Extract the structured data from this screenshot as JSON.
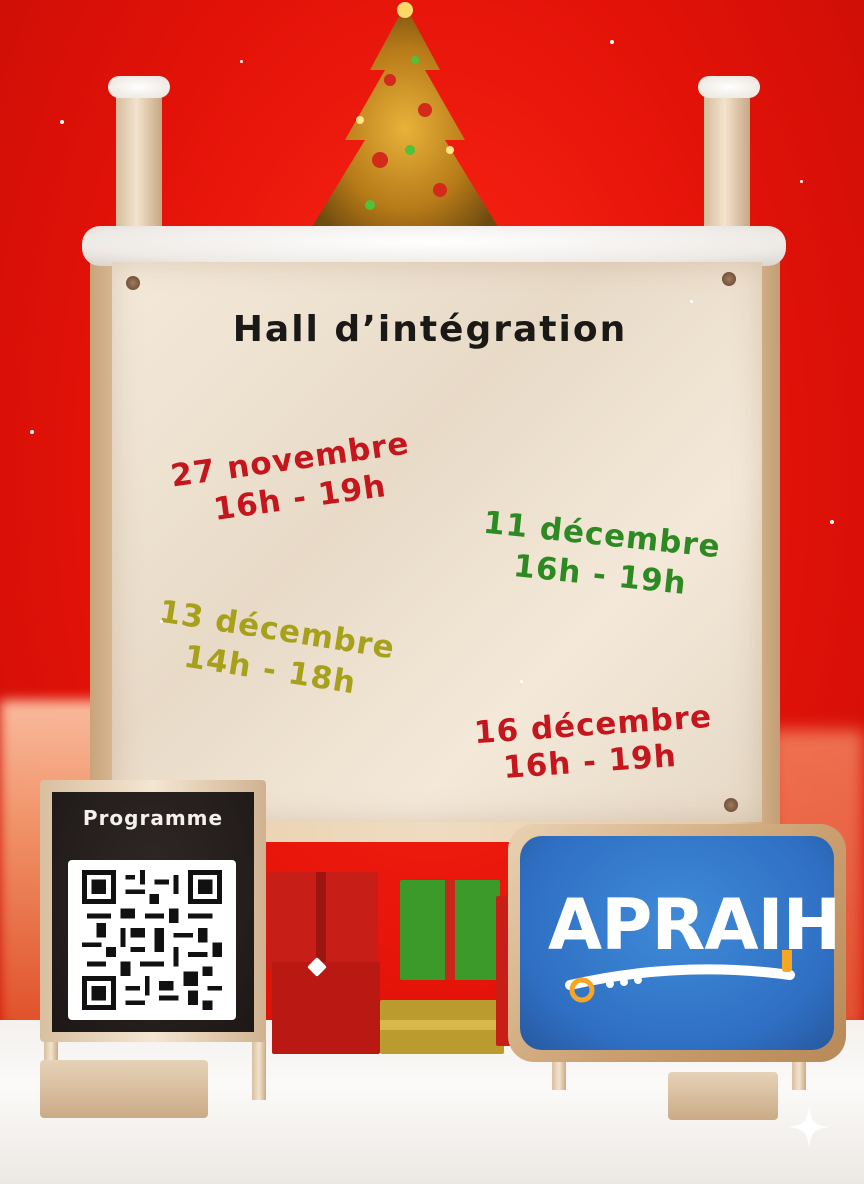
{
  "title": "Hall d’intégration",
  "dates": [
    {
      "date": "27 novembre",
      "hours": "16h - 19h",
      "color": "#c4161c"
    },
    {
      "date": "11 décembre",
      "hours": "16h - 19h",
      "color": "#2d8a22"
    },
    {
      "date": "13 décembre",
      "hours": "14h - 18h",
      "color": "#a7a01a"
    },
    {
      "date": "16 décembre",
      "hours": "16h - 19h",
      "color": "#c4161c"
    }
  ],
  "chalkboard": {
    "label": "Programme",
    "qr": "qr-code"
  },
  "logo": {
    "text": "APRAIH",
    "bg_color": "#2f6fc3",
    "accent_color": "#f5a623"
  },
  "icons": [
    "christmas-tree-icon",
    "gift-icon",
    "qr-code-icon",
    "sparkle-icon"
  ],
  "colors": {
    "background": "#e31208",
    "snow": "#f7f4f1",
    "paper": "#f1e3cf"
  }
}
